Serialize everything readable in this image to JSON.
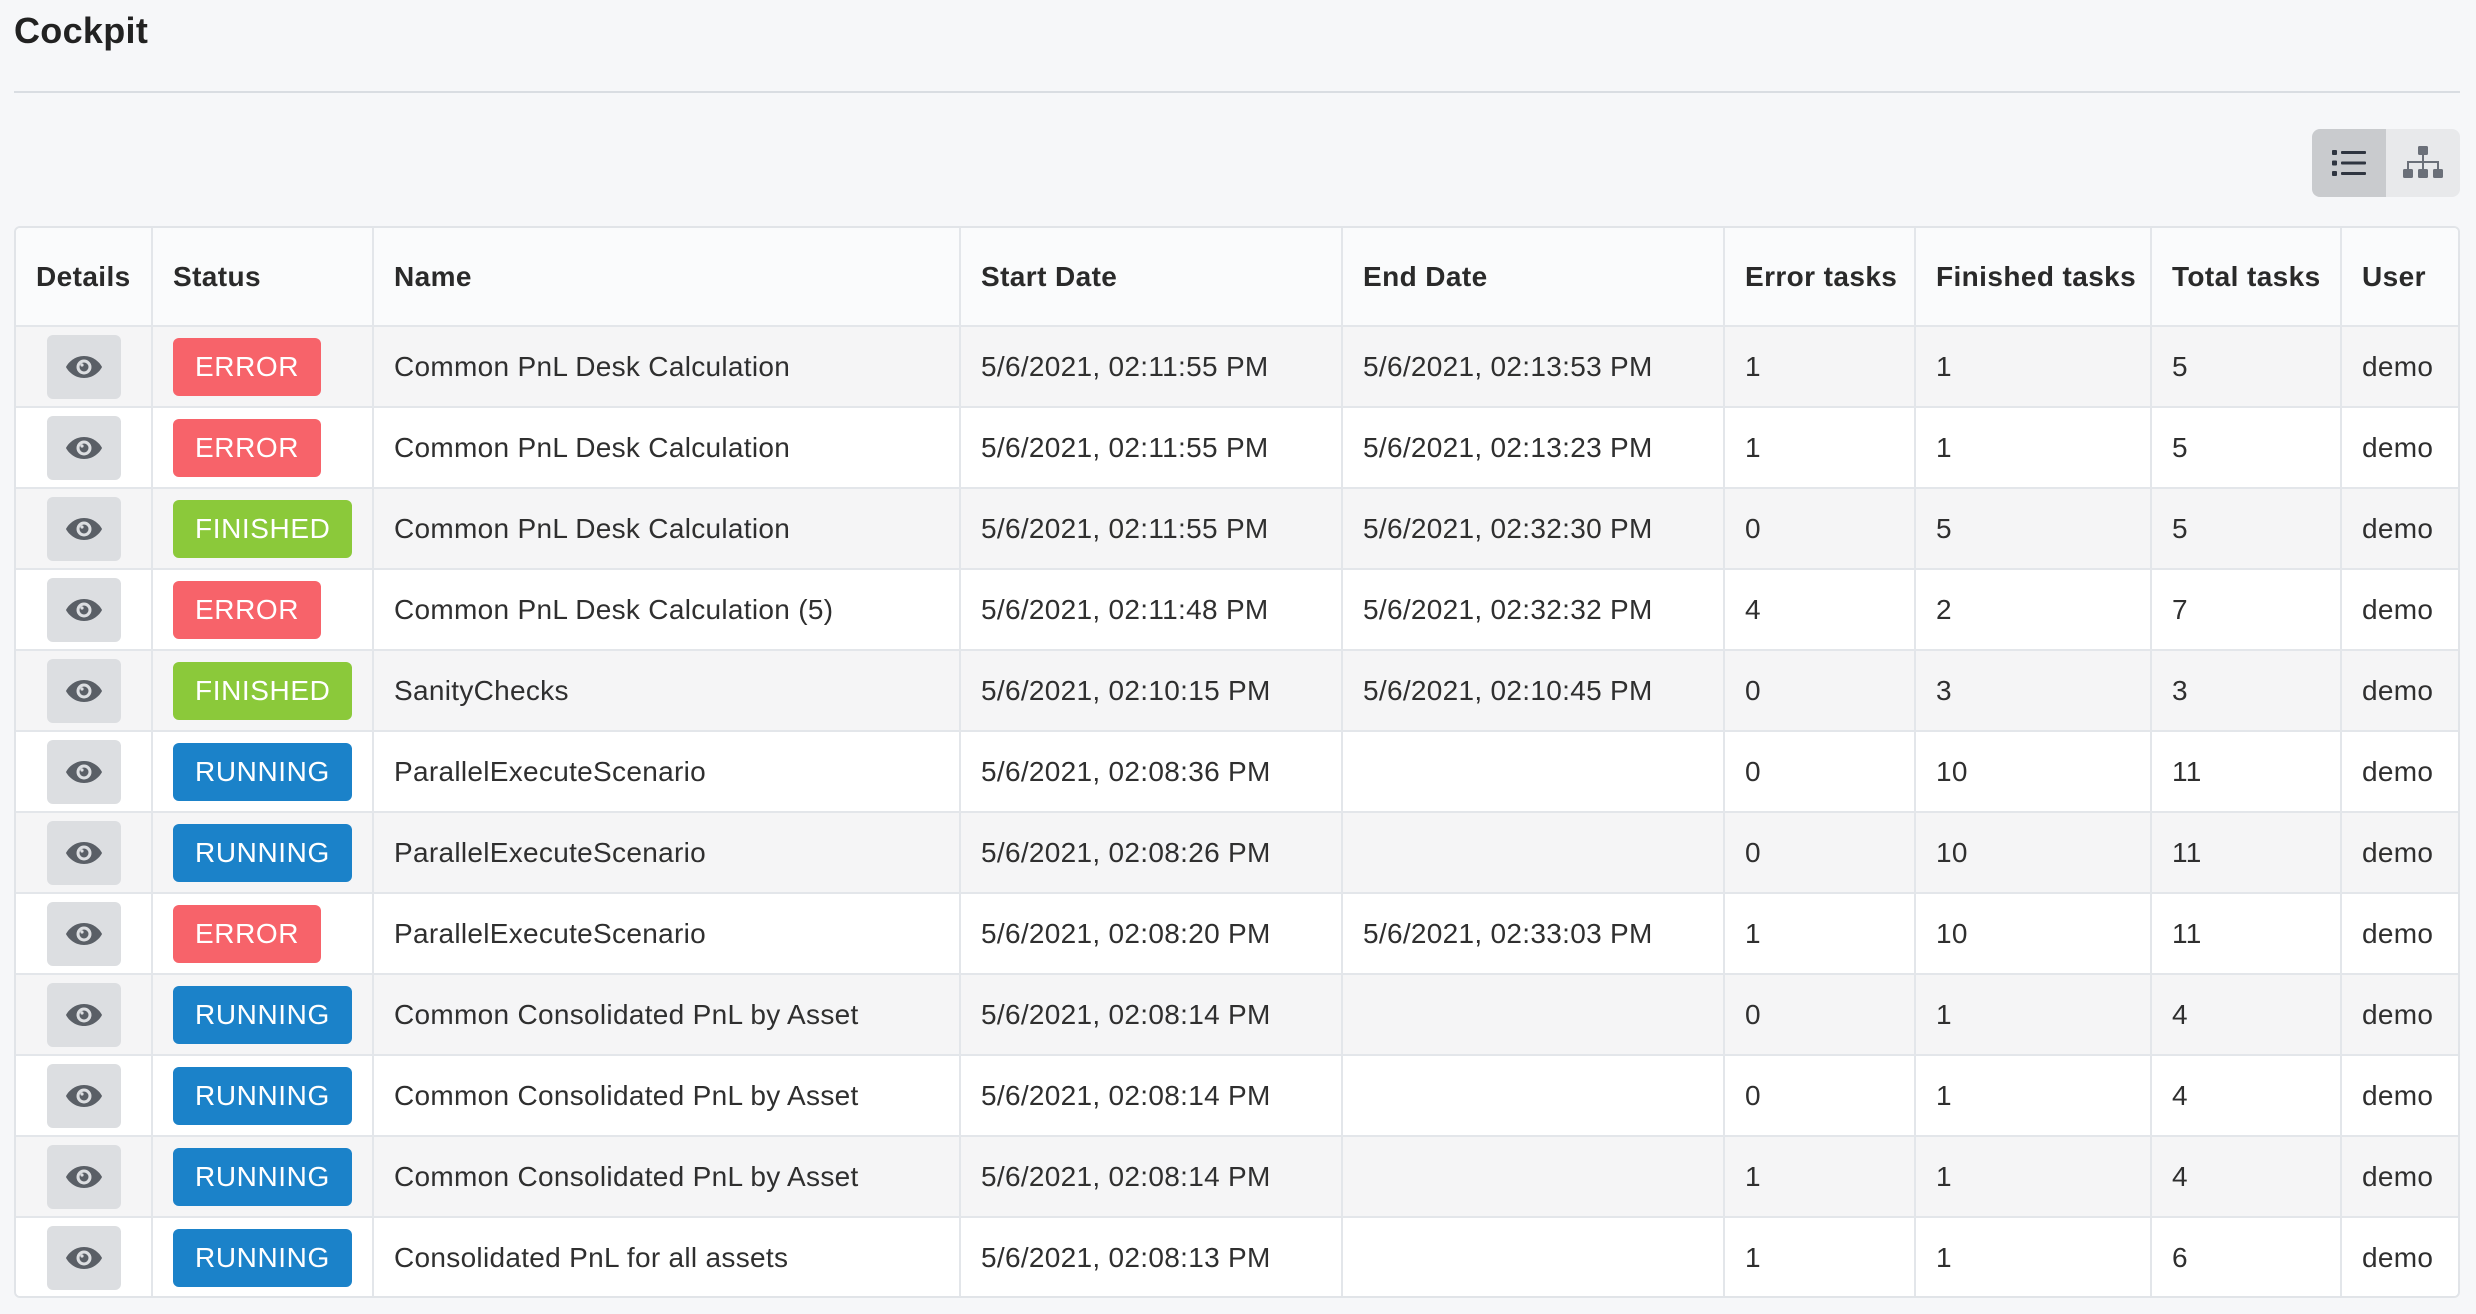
{
  "page": {
    "title": "Cockpit"
  },
  "view_toggle": {
    "list_icon": "list-icon",
    "tree_icon": "sitemap-icon",
    "active": "list"
  },
  "table": {
    "columns": [
      "Details",
      "Status",
      "Name",
      "Start Date",
      "End Date",
      "Error tasks",
      "Finished tasks",
      "Total tasks",
      "User"
    ],
    "status_colors": {
      "ERROR": "#f7636a",
      "FINISHED": "#8bc93a",
      "RUNNING": "#1b82c9"
    },
    "rows": [
      {
        "details_icon": "eye-icon",
        "status": "ERROR",
        "name": "Common PnL Desk Calculation",
        "start": "5/6/2021, 02:11:55 PM",
        "end": "5/6/2021, 02:13:53 PM",
        "error_tasks": "1",
        "finished_tasks": "1",
        "total_tasks": "5",
        "user": "demo"
      },
      {
        "details_icon": "eye-icon",
        "status": "ERROR",
        "name": "Common PnL Desk Calculation",
        "start": "5/6/2021, 02:11:55 PM",
        "end": "5/6/2021, 02:13:23 PM",
        "error_tasks": "1",
        "finished_tasks": "1",
        "total_tasks": "5",
        "user": "demo"
      },
      {
        "details_icon": "eye-icon",
        "status": "FINISHED",
        "name": "Common PnL Desk Calculation",
        "start": "5/6/2021, 02:11:55 PM",
        "end": "5/6/2021, 02:32:30 PM",
        "error_tasks": "0",
        "finished_tasks": "5",
        "total_tasks": "5",
        "user": "demo"
      },
      {
        "details_icon": "eye-icon",
        "status": "ERROR",
        "name": "Common PnL Desk Calculation (5)",
        "start": "5/6/2021, 02:11:48 PM",
        "end": "5/6/2021, 02:32:32 PM",
        "error_tasks": "4",
        "finished_tasks": "2",
        "total_tasks": "7",
        "user": "demo"
      },
      {
        "details_icon": "eye-icon",
        "status": "FINISHED",
        "name": "SanityChecks",
        "start": "5/6/2021, 02:10:15 PM",
        "end": "5/6/2021, 02:10:45 PM",
        "error_tasks": "0",
        "finished_tasks": "3",
        "total_tasks": "3",
        "user": "demo"
      },
      {
        "details_icon": "eye-icon",
        "status": "RUNNING",
        "name": "ParallelExecuteScenario",
        "start": "5/6/2021, 02:08:36 PM",
        "end": "",
        "error_tasks": "0",
        "finished_tasks": "10",
        "total_tasks": "11",
        "user": "demo"
      },
      {
        "details_icon": "eye-icon",
        "status": "RUNNING",
        "name": "ParallelExecuteScenario",
        "start": "5/6/2021, 02:08:26 PM",
        "end": "",
        "error_tasks": "0",
        "finished_tasks": "10",
        "total_tasks": "11",
        "user": "demo"
      },
      {
        "details_icon": "eye-icon",
        "status": "ERROR",
        "name": "ParallelExecuteScenario",
        "start": "5/6/2021, 02:08:20 PM",
        "end": "5/6/2021, 02:33:03 PM",
        "error_tasks": "1",
        "finished_tasks": "10",
        "total_tasks": "11",
        "user": "demo"
      },
      {
        "details_icon": "eye-icon",
        "status": "RUNNING",
        "name": "Common Consolidated PnL by Asset",
        "start": "5/6/2021, 02:08:14 PM",
        "end": "",
        "error_tasks": "0",
        "finished_tasks": "1",
        "total_tasks": "4",
        "user": "demo"
      },
      {
        "details_icon": "eye-icon",
        "status": "RUNNING",
        "name": "Common Consolidated PnL by Asset",
        "start": "5/6/2021, 02:08:14 PM",
        "end": "",
        "error_tasks": "0",
        "finished_tasks": "1",
        "total_tasks": "4",
        "user": "demo"
      },
      {
        "details_icon": "eye-icon",
        "status": "RUNNING",
        "name": "Common Consolidated PnL by Asset",
        "start": "5/6/2021, 02:08:14 PM",
        "end": "",
        "error_tasks": "1",
        "finished_tasks": "1",
        "total_tasks": "4",
        "user": "demo"
      },
      {
        "details_icon": "eye-icon",
        "status": "RUNNING",
        "name": "Consolidated PnL for all assets",
        "start": "5/6/2021, 02:08:13 PM",
        "end": "",
        "error_tasks": "1",
        "finished_tasks": "1",
        "total_tasks": "6",
        "user": "demo"
      }
    ]
  }
}
